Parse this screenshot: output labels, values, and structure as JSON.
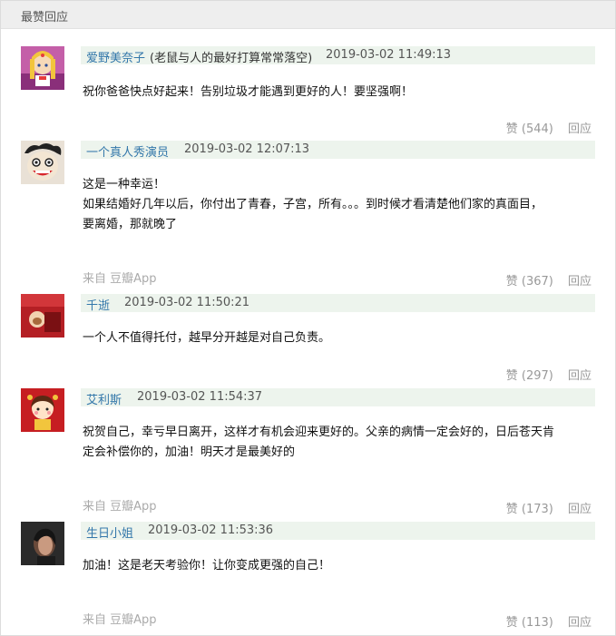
{
  "section_title": "最赞回应",
  "colors": {
    "author_link": "#3377aa",
    "meta_bar_bg": "#edf4ed",
    "muted": "#999999"
  },
  "comments": [
    {
      "author": "爱野美奈子",
      "signature": "(老鼠与人的最好打算常常落空)",
      "time": "2019-03-02 11:49:13",
      "lines": [
        "祝你爸爸快点好起来！告别垃圾才能遇到更好的人！要坚强啊！"
      ],
      "source": "",
      "likes": "赞 (544)",
      "reply": "回应",
      "avatar_icon": "anime-girl-avatar"
    },
    {
      "author": "一个真人秀演员",
      "signature": "",
      "time": "2019-03-02 12:07:13",
      "lines": [
        "这是一种幸运！",
        "如果结婚好几年以后，你付出了青春，子宫，所有。。。到时候才看清楚他们家的真面目，",
        "要离婚，那就晚了"
      ],
      "source": "来自 豆瓣App",
      "likes": "赞 (367)",
      "reply": "回应",
      "avatar_icon": "cartoon-face-avatar"
    },
    {
      "author": "千逝",
      "signature": "",
      "time": "2019-03-02 11:50:21",
      "lines": [
        "一个人不值得托付，越早分开越是对自己负责。"
      ],
      "source": "",
      "likes": "赞 (297)",
      "reply": "回应",
      "avatar_icon": "red-photo-avatar"
    },
    {
      "author": "艾利斯",
      "signature": "",
      "time": "2019-03-02 11:54:37",
      "lines": [
        "祝贺自己，幸亏早日离开，这样才有机会迎来更好的。父亲的病情一定会好的，日后苍天肯",
        "定会补偿你的，加油！明天才是最美好的"
      ],
      "source": "来自 豆瓣App",
      "likes": "赞 (173)",
      "reply": "回应",
      "avatar_icon": "cartoon-girl-avatar"
    },
    {
      "author": "生日小姐",
      "signature": "",
      "time": "2019-03-02 11:53:36",
      "lines": [
        "加油！这是老天考验你！让你变成更强的自己！"
      ],
      "source": "来自 豆瓣App",
      "likes": "赞 (113)",
      "reply": "回应",
      "avatar_icon": "portrait-avatar"
    }
  ]
}
